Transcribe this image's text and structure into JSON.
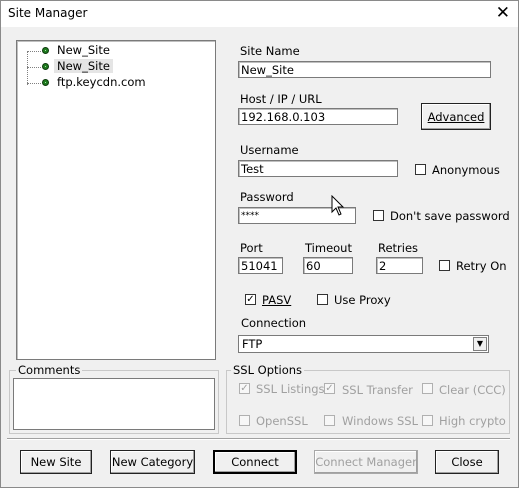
{
  "window": {
    "title": "Site Manager",
    "close_glyph": "✕"
  },
  "tree": {
    "items": [
      {
        "label": "New_Site",
        "selected": false
      },
      {
        "label": "New_Site",
        "selected": true
      },
      {
        "label": "ftp.keycdn.com",
        "selected": false
      }
    ]
  },
  "form": {
    "site_name_label": "Site Name",
    "site_name_value": "New_Site",
    "host_label": "Host / IP / URL",
    "host_value": "192.168.0.103",
    "advanced_button": "Advanced",
    "username_label": "Username",
    "username_value": "Test",
    "anonymous_label": "Anonymous",
    "anonymous_checked": false,
    "password_label": "Password",
    "password_value": "****",
    "dont_save_password_label": "Don't save password",
    "port_label": "Port",
    "port_value": "51041",
    "timeout_label": "Timeout",
    "timeout_value": "60",
    "retries_label": "Retries",
    "retries_value": "2",
    "retry_on_label": "Retry On",
    "pasv_label": "PASV",
    "pasv_checked": true,
    "use_proxy_label": "Use Proxy",
    "connection_label": "Connection",
    "connection_value": "FTP"
  },
  "comments": {
    "label": "Comments"
  },
  "ssl": {
    "label": "SSL Options",
    "ssl_listings": "SSL Listings",
    "ssl_transfer": "SSL Transfer",
    "clear_ccc": "Clear (CCC)",
    "openssl": "OpenSSL",
    "windows_ssl": "Windows SSL",
    "high_crypto": "High crypto"
  },
  "buttons": {
    "new_site": "New Site",
    "new_category": "New Category",
    "connect": "Connect",
    "connect_manager": "Connect Manager",
    "close": "Close"
  },
  "check_glyph": "✓"
}
